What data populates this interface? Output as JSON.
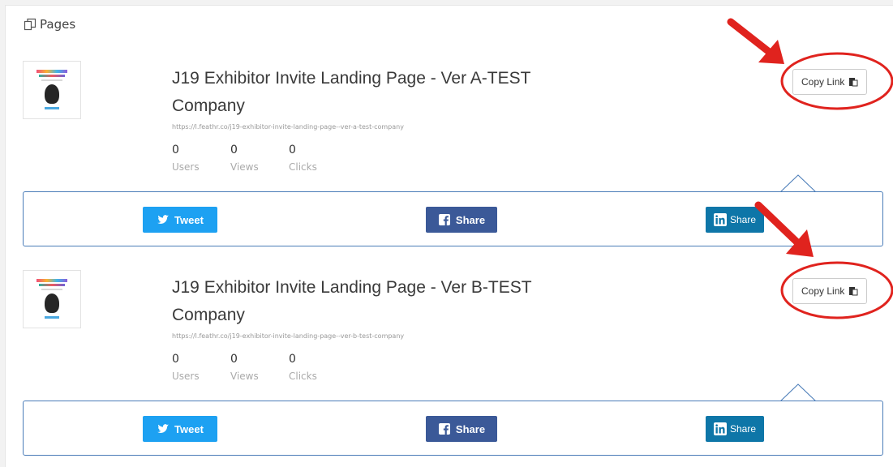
{
  "section": {
    "title": "Pages"
  },
  "cards": [
    {
      "title": "J19 Exhibitor Invite Landing Page - Ver A-TEST Company",
      "url": "https://l.feathr.co/j19-exhibitor-invite-landing-page--ver-a-test-company",
      "stats": [
        {
          "value": "0",
          "label": "Users"
        },
        {
          "value": "0",
          "label": "Views"
        },
        {
          "value": "0",
          "label": "Clicks"
        }
      ],
      "copy_label": "Copy Link",
      "share": {
        "tweet": "Tweet",
        "facebook": "Share",
        "linkedin": "Share"
      }
    },
    {
      "title": "J19 Exhibitor Invite Landing Page - Ver B-TEST Company",
      "url": "https://l.feathr.co/j19-exhibitor-invite-landing-page--ver-b-test-company",
      "stats": [
        {
          "value": "0",
          "label": "Users"
        },
        {
          "value": "0",
          "label": "Views"
        },
        {
          "value": "0",
          "label": "Clicks"
        }
      ],
      "copy_label": "Copy Link",
      "share": {
        "tweet": "Tweet",
        "facebook": "Share",
        "linkedin": "Share"
      }
    }
  ],
  "colors": {
    "twitter": "#1da1f2",
    "facebook": "#3b5998",
    "linkedin": "#0e76a8",
    "share_border": "#4a7cb8",
    "annotation": "#e0231e"
  }
}
